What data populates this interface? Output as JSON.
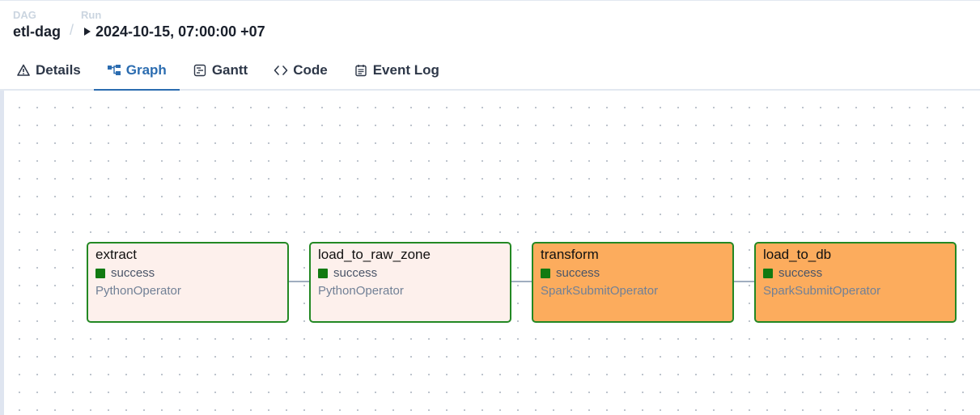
{
  "breadcrumb": {
    "dag_label": "DAG",
    "dag_value": "etl-dag",
    "separator": "/",
    "run_label": "Run",
    "run_value": "2024-10-15, 07:00:00 +07"
  },
  "tabs": [
    {
      "label": "Details",
      "icon": "warning-triangle-icon"
    },
    {
      "label": "Graph",
      "icon": "graph-icon",
      "active": true
    },
    {
      "label": "Gantt",
      "icon": "gantt-icon"
    },
    {
      "label": "Code",
      "icon": "code-icon"
    },
    {
      "label": "Event Log",
      "icon": "event-log-icon"
    }
  ],
  "graph": {
    "nodes": [
      {
        "name": "extract",
        "state": "success",
        "operator": "PythonOperator"
      },
      {
        "name": "load_to_raw_zone",
        "state": "success",
        "operator": "PythonOperator"
      },
      {
        "name": "transform",
        "state": "success",
        "operator": "SparkSubmitOperator"
      },
      {
        "name": "load_to_db",
        "state": "success",
        "operator": "SparkSubmitOperator"
      }
    ]
  },
  "colors": {
    "accent": "#2b6cb0",
    "success": "#117a11",
    "node_border": "#238823",
    "python_node_bg": "#fdf0ec",
    "spark_node_bg": "#fcac5d"
  }
}
